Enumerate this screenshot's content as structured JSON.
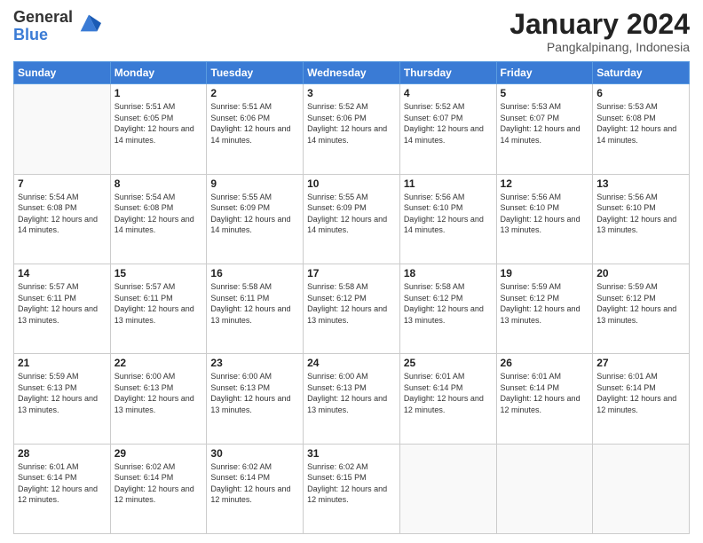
{
  "logo": {
    "general": "General",
    "blue": "Blue"
  },
  "title": "January 2024",
  "subtitle": "Pangkalpinang, Indonesia",
  "days_of_week": [
    "Sunday",
    "Monday",
    "Tuesday",
    "Wednesday",
    "Thursday",
    "Friday",
    "Saturday"
  ],
  "weeks": [
    [
      {
        "day": "",
        "sunrise": "",
        "sunset": "",
        "daylight": ""
      },
      {
        "day": "1",
        "sunrise": "Sunrise: 5:51 AM",
        "sunset": "Sunset: 6:05 PM",
        "daylight": "Daylight: 12 hours and 14 minutes."
      },
      {
        "day": "2",
        "sunrise": "Sunrise: 5:51 AM",
        "sunset": "Sunset: 6:06 PM",
        "daylight": "Daylight: 12 hours and 14 minutes."
      },
      {
        "day": "3",
        "sunrise": "Sunrise: 5:52 AM",
        "sunset": "Sunset: 6:06 PM",
        "daylight": "Daylight: 12 hours and 14 minutes."
      },
      {
        "day": "4",
        "sunrise": "Sunrise: 5:52 AM",
        "sunset": "Sunset: 6:07 PM",
        "daylight": "Daylight: 12 hours and 14 minutes."
      },
      {
        "day": "5",
        "sunrise": "Sunrise: 5:53 AM",
        "sunset": "Sunset: 6:07 PM",
        "daylight": "Daylight: 12 hours and 14 minutes."
      },
      {
        "day": "6",
        "sunrise": "Sunrise: 5:53 AM",
        "sunset": "Sunset: 6:08 PM",
        "daylight": "Daylight: 12 hours and 14 minutes."
      }
    ],
    [
      {
        "day": "7",
        "sunrise": "Sunrise: 5:54 AM",
        "sunset": "Sunset: 6:08 PM",
        "daylight": "Daylight: 12 hours and 14 minutes."
      },
      {
        "day": "8",
        "sunrise": "Sunrise: 5:54 AM",
        "sunset": "Sunset: 6:08 PM",
        "daylight": "Daylight: 12 hours and 14 minutes."
      },
      {
        "day": "9",
        "sunrise": "Sunrise: 5:55 AM",
        "sunset": "Sunset: 6:09 PM",
        "daylight": "Daylight: 12 hours and 14 minutes."
      },
      {
        "day": "10",
        "sunrise": "Sunrise: 5:55 AM",
        "sunset": "Sunset: 6:09 PM",
        "daylight": "Daylight: 12 hours and 14 minutes."
      },
      {
        "day": "11",
        "sunrise": "Sunrise: 5:56 AM",
        "sunset": "Sunset: 6:10 PM",
        "daylight": "Daylight: 12 hours and 14 minutes."
      },
      {
        "day": "12",
        "sunrise": "Sunrise: 5:56 AM",
        "sunset": "Sunset: 6:10 PM",
        "daylight": "Daylight: 12 hours and 13 minutes."
      },
      {
        "day": "13",
        "sunrise": "Sunrise: 5:56 AM",
        "sunset": "Sunset: 6:10 PM",
        "daylight": "Daylight: 12 hours and 13 minutes."
      }
    ],
    [
      {
        "day": "14",
        "sunrise": "Sunrise: 5:57 AM",
        "sunset": "Sunset: 6:11 PM",
        "daylight": "Daylight: 12 hours and 13 minutes."
      },
      {
        "day": "15",
        "sunrise": "Sunrise: 5:57 AM",
        "sunset": "Sunset: 6:11 PM",
        "daylight": "Daylight: 12 hours and 13 minutes."
      },
      {
        "day": "16",
        "sunrise": "Sunrise: 5:58 AM",
        "sunset": "Sunset: 6:11 PM",
        "daylight": "Daylight: 12 hours and 13 minutes."
      },
      {
        "day": "17",
        "sunrise": "Sunrise: 5:58 AM",
        "sunset": "Sunset: 6:12 PM",
        "daylight": "Daylight: 12 hours and 13 minutes."
      },
      {
        "day": "18",
        "sunrise": "Sunrise: 5:58 AM",
        "sunset": "Sunset: 6:12 PM",
        "daylight": "Daylight: 12 hours and 13 minutes."
      },
      {
        "day": "19",
        "sunrise": "Sunrise: 5:59 AM",
        "sunset": "Sunset: 6:12 PM",
        "daylight": "Daylight: 12 hours and 13 minutes."
      },
      {
        "day": "20",
        "sunrise": "Sunrise: 5:59 AM",
        "sunset": "Sunset: 6:12 PM",
        "daylight": "Daylight: 12 hours and 13 minutes."
      }
    ],
    [
      {
        "day": "21",
        "sunrise": "Sunrise: 5:59 AM",
        "sunset": "Sunset: 6:13 PM",
        "daylight": "Daylight: 12 hours and 13 minutes."
      },
      {
        "day": "22",
        "sunrise": "Sunrise: 6:00 AM",
        "sunset": "Sunset: 6:13 PM",
        "daylight": "Daylight: 12 hours and 13 minutes."
      },
      {
        "day": "23",
        "sunrise": "Sunrise: 6:00 AM",
        "sunset": "Sunset: 6:13 PM",
        "daylight": "Daylight: 12 hours and 13 minutes."
      },
      {
        "day": "24",
        "sunrise": "Sunrise: 6:00 AM",
        "sunset": "Sunset: 6:13 PM",
        "daylight": "Daylight: 12 hours and 13 minutes."
      },
      {
        "day": "25",
        "sunrise": "Sunrise: 6:01 AM",
        "sunset": "Sunset: 6:14 PM",
        "daylight": "Daylight: 12 hours and 12 minutes."
      },
      {
        "day": "26",
        "sunrise": "Sunrise: 6:01 AM",
        "sunset": "Sunset: 6:14 PM",
        "daylight": "Daylight: 12 hours and 12 minutes."
      },
      {
        "day": "27",
        "sunrise": "Sunrise: 6:01 AM",
        "sunset": "Sunset: 6:14 PM",
        "daylight": "Daylight: 12 hours and 12 minutes."
      }
    ],
    [
      {
        "day": "28",
        "sunrise": "Sunrise: 6:01 AM",
        "sunset": "Sunset: 6:14 PM",
        "daylight": "Daylight: 12 hours and 12 minutes."
      },
      {
        "day": "29",
        "sunrise": "Sunrise: 6:02 AM",
        "sunset": "Sunset: 6:14 PM",
        "daylight": "Daylight: 12 hours and 12 minutes."
      },
      {
        "day": "30",
        "sunrise": "Sunrise: 6:02 AM",
        "sunset": "Sunset: 6:14 PM",
        "daylight": "Daylight: 12 hours and 12 minutes."
      },
      {
        "day": "31",
        "sunrise": "Sunrise: 6:02 AM",
        "sunset": "Sunset: 6:15 PM",
        "daylight": "Daylight: 12 hours and 12 minutes."
      },
      {
        "day": "",
        "sunrise": "",
        "sunset": "",
        "daylight": ""
      },
      {
        "day": "",
        "sunrise": "",
        "sunset": "",
        "daylight": ""
      },
      {
        "day": "",
        "sunrise": "",
        "sunset": "",
        "daylight": ""
      }
    ]
  ]
}
